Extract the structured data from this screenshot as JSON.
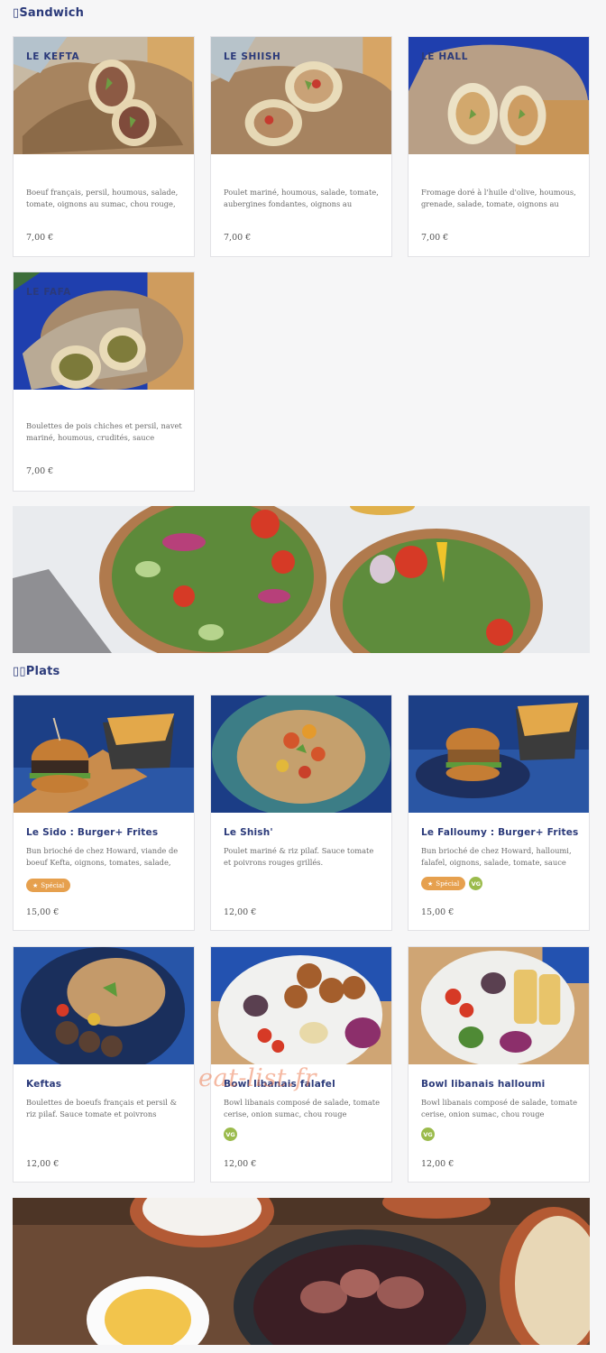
{
  "sections": [
    {
      "title": "Sandwich",
      "icon": "sandwich-icon"
    },
    {
      "title": "Plats",
      "icon": "plate-icon"
    }
  ],
  "sandwich_items": [
    {
      "name": "LE KEFTA",
      "desc": "Boeuf français, persil, houmous, salade, tomate, oignons au sumac, chou rouge, sauc...",
      "price": "7,00 €"
    },
    {
      "name": "LE SHIISH",
      "desc": "Poulet mariné, houmous, salade, tomate, aubergines fondantes, oignons au sumac,...",
      "price": "7,00 €"
    },
    {
      "name": "LE HALL",
      "desc": "Fromage doré à l'huile d'olive, houmous, grenade, salade, tomate, oignons au sumac,...",
      "price": "7,00 €"
    },
    {
      "name": "LE FAFA",
      "desc": "Boulettes de pois chiches et persil, navet mariné, houmous, crudités, sauce sésame",
      "price": "7,00 €"
    }
  ],
  "plats_items": [
    {
      "name": "Le Sido : Burger+ Frites",
      "desc": "Bun brioché de chez Howard, viande de boeuf Kefta, oignons, tomates, salade, sauce yaourt...",
      "price": "15,00 €",
      "special": "Spécial",
      "vg": ""
    },
    {
      "name": "Le Shish'",
      "desc": "Poulet mariné & riz pilaf. Sauce tomate et poivrons rouges grillés.",
      "price": "12,00 €",
      "special": "",
      "vg": ""
    },
    {
      "name": "Le Falloumy : Burger+ Frites",
      "desc": "Bun brioché de chez Howard, halloumi, falafel, oignons, salade, tomate, sauce yaourt...",
      "price": "15,00 €",
      "special": "Spécial",
      "vg": "VG"
    },
    {
      "name": "Keftas",
      "desc": "Boulettes de boeufs français et persil & riz pilaf. Sauce tomate et poivrons rouges grillés.",
      "price": "12,00 €",
      "special": "",
      "vg": ""
    },
    {
      "name": "Bowl libanais falafel",
      "desc": "Bowl libanais composé de salade, tomate cerise, onion sumac, chou rouge mariné,...",
      "price": "12,00 €",
      "special": "",
      "vg": "VG"
    },
    {
      "name": "Bowl libanais halloumi",
      "desc": "Bowl libanais composé de salade, tomate cerise, onion sumac, chou rouge mariné,...",
      "price": "12,00 €",
      "special": "",
      "vg": "VG"
    }
  ],
  "watermark": "eat-list.fr",
  "colors": {
    "title_blue": "#2b3a7a",
    "special_orange": "#e6a04e",
    "vg_green": "#9bbb4c",
    "watermark": "#ec825a"
  }
}
